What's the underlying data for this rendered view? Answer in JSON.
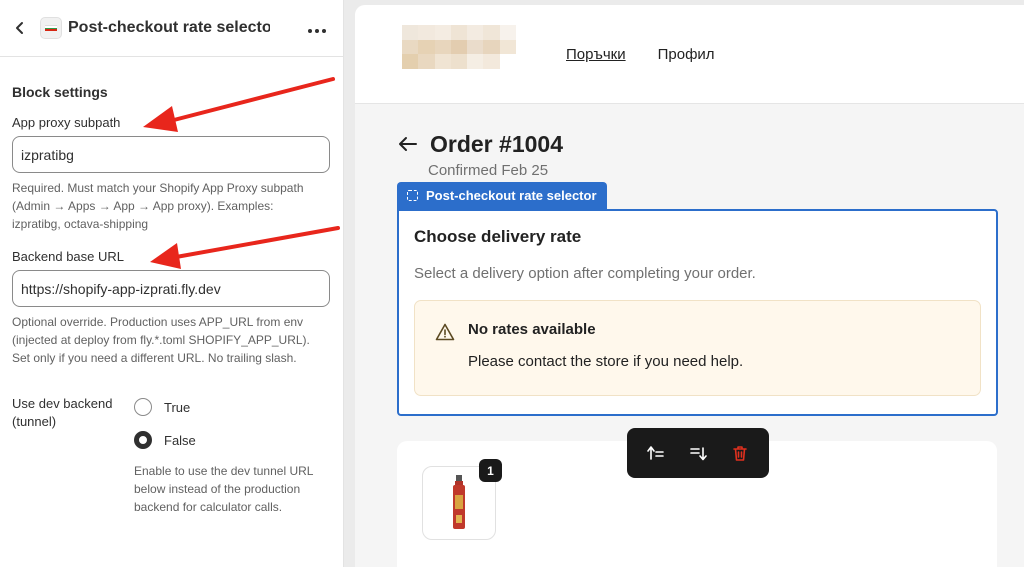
{
  "editor": {
    "back_label": "‹",
    "title": "Post-checkout rate selector",
    "more_label": "•••",
    "section_title": "Block settings",
    "fields": {
      "proxy": {
        "label": "App proxy subpath",
        "value": "izpratibg",
        "help": "Required. Must match your Shopify App Proxy subpath (Admin → Apps → App → App proxy). Examples: izpratibg, octava-shipping"
      },
      "backend": {
        "label": "Backend base URL",
        "value": "https://shopify-app-izprati.fly.dev",
        "help": "Optional override. Production uses APP_URL from env (injected at deploy from fly.*.toml SHOPIFY_APP_URL). Set only if you need a different URL. No trailing slash."
      },
      "dev": {
        "label": "Use dev backend (tunnel)",
        "options": [
          "True",
          "False"
        ],
        "selected": "False",
        "help": "Enable to use the dev tunnel URL below instead of the production backend for calculator calls."
      }
    }
  },
  "store": {
    "nav": [
      "Поръчки",
      "Профил"
    ],
    "order_title": "Order #1004",
    "order_sub": "Confirmed Feb 25",
    "block_tag": "Post-checkout rate selector",
    "block": {
      "title": "Choose delivery rate",
      "desc": "Select a delivery option after completing your order.",
      "notice_title": "No rates available",
      "notice_text": "Please contact the store if you need help."
    },
    "item_qty": "1"
  },
  "colors": {
    "accent": "#2c6ecb",
    "arrow": "#e8261c",
    "delete": "#e0301e",
    "notice_bg": "#fff8ec"
  }
}
